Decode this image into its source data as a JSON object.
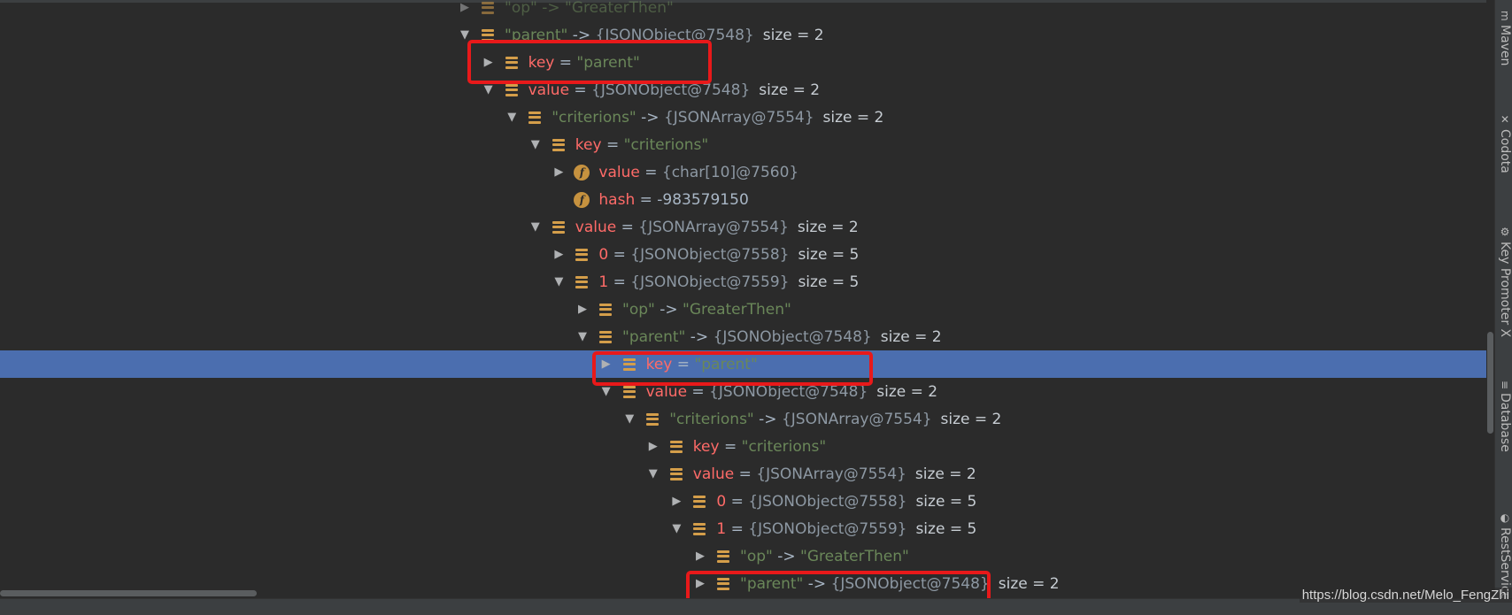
{
  "tree": {
    "rows": [
      {
        "indent": 0,
        "toggle": "expanded-partial",
        "icon": "list",
        "label": "\"op\" -> \"GreaterThen\"",
        "label_class": "k-str",
        "size": "",
        "selected": false,
        "name": "tree-row-op-top"
      },
      {
        "indent": 0,
        "toggle": "expanded",
        "icon": "list",
        "label": "\"parent\"",
        "label_class": "k-str",
        "mid": " -> ",
        "ref": "{JSONObject@7548}",
        "size": "size = 2",
        "selected": false,
        "name": "tree-row-parent-0"
      },
      {
        "indent": 1,
        "toggle": "collapsed",
        "icon": "list",
        "label": "key",
        "label_class": "k-red",
        "mid": " = ",
        "ref": "\"parent\"",
        "ref_class": "k-str",
        "size": "",
        "selected": false,
        "name": "tree-row-key-parent-1"
      },
      {
        "indent": 1,
        "toggle": "expanded",
        "icon": "list",
        "label": "value",
        "label_class": "k-red",
        "mid": " = ",
        "ref": "{JSONObject@7548}",
        "size": "size = 2",
        "selected": false,
        "name": "tree-row-value-1"
      },
      {
        "indent": 2,
        "toggle": "expanded",
        "icon": "list",
        "label": "\"criterions\"",
        "label_class": "k-str",
        "mid": " -> ",
        "ref": "{JSONArray@7554}",
        "size": "size = 2",
        "selected": false,
        "name": "tree-row-criterions-2"
      },
      {
        "indent": 3,
        "toggle": "expanded",
        "icon": "list",
        "label": "key",
        "label_class": "k-red",
        "mid": " = ",
        "ref": "\"criterions\"",
        "ref_class": "k-str",
        "size": "",
        "selected": false,
        "name": "tree-row-key-criterions-3"
      },
      {
        "indent": 4,
        "toggle": "collapsed",
        "icon": "field",
        "label": "value",
        "label_class": "k-red",
        "mid": " = ",
        "ref": "{char[10]@7560}",
        "size": "",
        "selected": false,
        "name": "tree-row-char-value-4"
      },
      {
        "indent": 4,
        "toggle": "none",
        "icon": "field",
        "label": "hash",
        "label_class": "k-red",
        "mid": " = ",
        "ref": "-983579150",
        "ref_class": "k-eq",
        "size": "",
        "selected": false,
        "name": "tree-row-hash-4"
      },
      {
        "indent": 3,
        "toggle": "expanded",
        "icon": "list",
        "label": "value",
        "label_class": "k-red",
        "mid": " = ",
        "ref": "{JSONArray@7554}",
        "size": "size = 2",
        "selected": false,
        "name": "tree-row-value-array-3"
      },
      {
        "indent": 4,
        "toggle": "collapsed",
        "icon": "list",
        "label": "0",
        "label_class": "k-red",
        "mid": " = ",
        "ref": "{JSONObject@7558}",
        "size": "size = 5",
        "selected": false,
        "name": "tree-row-index-0-4"
      },
      {
        "indent": 4,
        "toggle": "expanded",
        "icon": "list",
        "label": "1",
        "label_class": "k-red",
        "mid": " = ",
        "ref": "{JSONObject@7559}",
        "size": "size = 5",
        "selected": false,
        "name": "tree-row-index-1-4"
      },
      {
        "indent": 5,
        "toggle": "collapsed",
        "icon": "list",
        "label": "\"op\"",
        "label_class": "k-str",
        "mid": " -> ",
        "ref": "\"GreaterThen\"",
        "ref_class": "k-str",
        "size": "",
        "selected": false,
        "name": "tree-row-op-5"
      },
      {
        "indent": 5,
        "toggle": "expanded",
        "icon": "list",
        "label": "\"parent\"",
        "label_class": "k-str",
        "mid": " -> ",
        "ref": "{JSONObject@7548}",
        "size": "size = 2",
        "selected": false,
        "name": "tree-row-parent-5"
      },
      {
        "indent": 6,
        "toggle": "collapsed",
        "icon": "list",
        "label": "key",
        "label_class": "k-red",
        "mid": " = ",
        "ref": "\"parent\"",
        "ref_class": "k-str",
        "size": "",
        "selected": true,
        "name": "tree-row-key-parent-6"
      },
      {
        "indent": 6,
        "toggle": "expanded",
        "icon": "list",
        "label": "value",
        "label_class": "k-red",
        "mid": " = ",
        "ref": "{JSONObject@7548}",
        "size": "size = 2",
        "selected": false,
        "name": "tree-row-value-6"
      },
      {
        "indent": 7,
        "toggle": "expanded",
        "icon": "list",
        "label": "\"criterions\"",
        "label_class": "k-str",
        "mid": " -> ",
        "ref": "{JSONArray@7554}",
        "size": "size = 2",
        "selected": false,
        "name": "tree-row-criterions-7"
      },
      {
        "indent": 8,
        "toggle": "collapsed",
        "icon": "list",
        "label": "key",
        "label_class": "k-red",
        "mid": " = ",
        "ref": "\"criterions\"",
        "ref_class": "k-str",
        "size": "",
        "selected": false,
        "name": "tree-row-key-criterions-8"
      },
      {
        "indent": 8,
        "toggle": "expanded",
        "icon": "list",
        "label": "value",
        "label_class": "k-red",
        "mid": " = ",
        "ref": "{JSONArray@7554}",
        "size": "size = 2",
        "selected": false,
        "name": "tree-row-value-array-8"
      },
      {
        "indent": 9,
        "toggle": "collapsed",
        "icon": "list",
        "label": "0",
        "label_class": "k-red",
        "mid": " = ",
        "ref": "{JSONObject@7558}",
        "size": "size = 5",
        "selected": false,
        "name": "tree-row-index-0-9"
      },
      {
        "indent": 9,
        "toggle": "expanded",
        "icon": "list",
        "label": "1",
        "label_class": "k-red",
        "mid": " = ",
        "ref": "{JSONObject@7559}",
        "size": "size = 5",
        "selected": false,
        "name": "tree-row-index-1-9"
      },
      {
        "indent": 10,
        "toggle": "collapsed",
        "icon": "list",
        "label": "\"op\"",
        "label_class": "k-str",
        "mid": " -> ",
        "ref": "\"GreaterThen\"",
        "ref_class": "k-str",
        "size": "",
        "selected": false,
        "name": "tree-row-op-10"
      },
      {
        "indent": 10,
        "toggle": "collapsed",
        "icon": "list",
        "label": "\"parent\"",
        "label_class": "k-str",
        "mid": " -> ",
        "ref": "{JSONObject@7548}",
        "size": "size = 2",
        "selected": false,
        "name": "tree-row-parent-10"
      }
    ]
  },
  "side_tabs": [
    {
      "label": "Maven",
      "icon": "m"
    },
    {
      "label": "Codota",
      "icon": "✕"
    },
    {
      "label": "Key Promoter X",
      "icon": "⚙"
    },
    {
      "label": "Database",
      "icon": "≡"
    },
    {
      "label": "RestServices",
      "icon": "◐"
    }
  ],
  "watermark": "https://blog.csdn.net/Melo_FengZhi",
  "colors": {
    "background": "#2b2b2b",
    "selection": "#4b6eaf",
    "name_red": "#ff6b68",
    "string_green": "#6a8759",
    "highlight_box": "#e8191a",
    "icon_orange": "#d49e4a"
  }
}
